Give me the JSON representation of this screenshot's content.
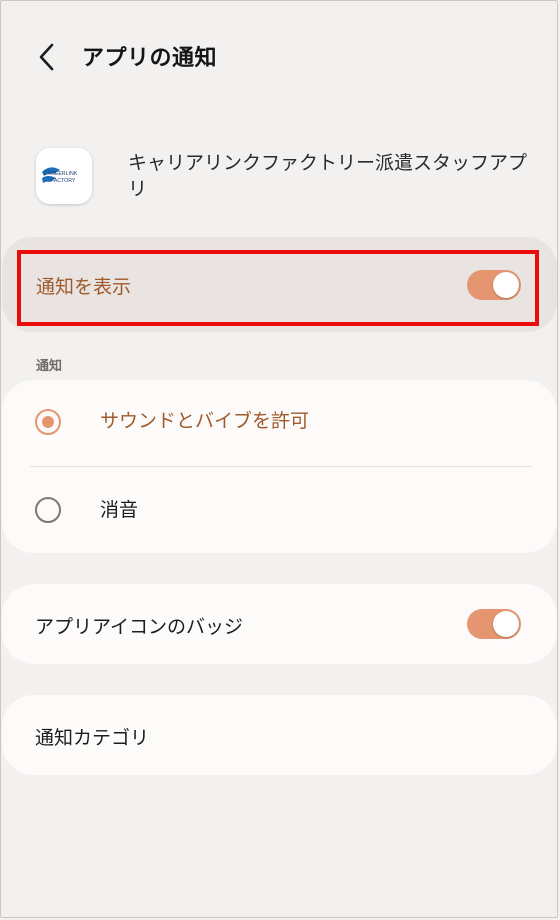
{
  "header": {
    "title": "アプリの通知",
    "back_icon": "chevron-left-icon"
  },
  "app": {
    "name": "キャリアリンクファクトリー派遣スタッフアプリ",
    "logo_text_1": "CAREERLINK",
    "logo_text_2": "FACTORY"
  },
  "show_notifications": {
    "label": "通知を表示",
    "enabled": true
  },
  "notifications_section": {
    "label": "通知",
    "options": [
      {
        "label": "サウンドとバイブを許可",
        "selected": true
      },
      {
        "label": "消音",
        "selected": false
      }
    ]
  },
  "badge": {
    "label": "アプリアイコンのバッジ",
    "enabled": true
  },
  "categories": {
    "label": "通知カテゴリ"
  },
  "colors": {
    "accent": "#e59670",
    "accent_text": "#a05a2c",
    "highlight": "#ea0b0b",
    "background": "#f3f1f0"
  }
}
